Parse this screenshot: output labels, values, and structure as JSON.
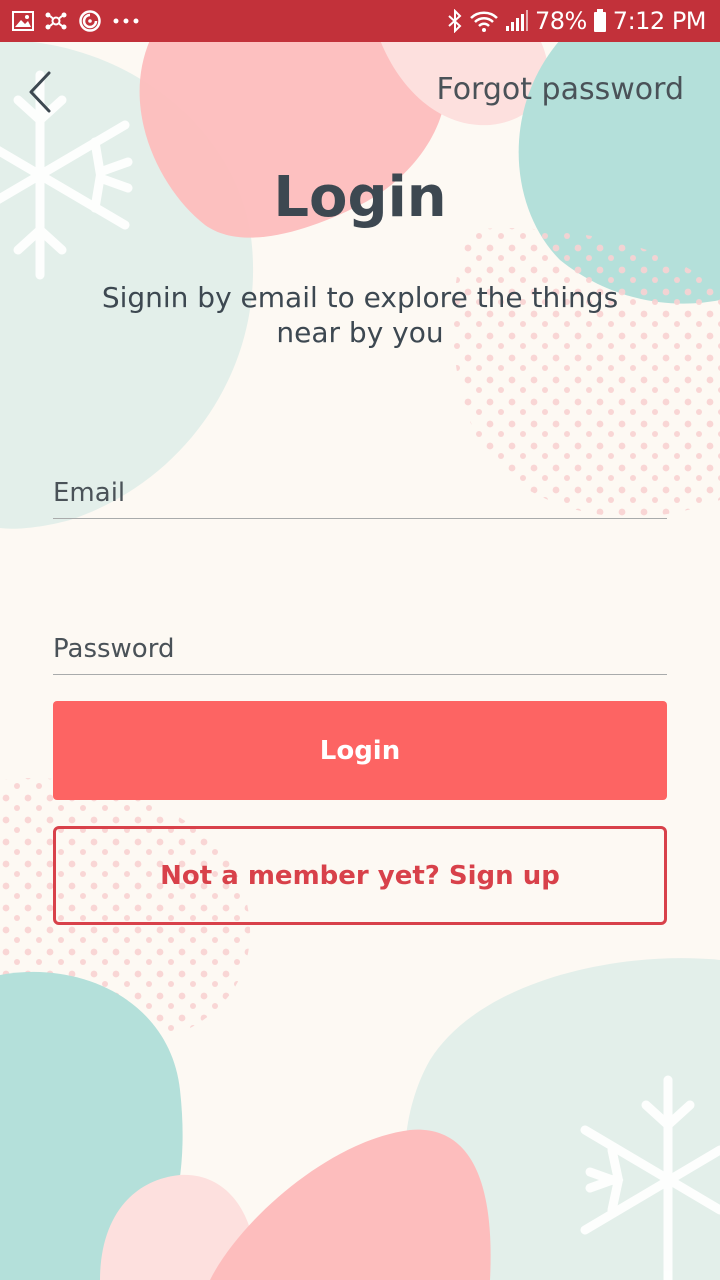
{
  "status_bar": {
    "battery_percent": "78%",
    "time": "7:12 PM",
    "left_icons": [
      "image-icon",
      "bluetooth-share-icon",
      "sync-icon",
      "more-dots-icon"
    ],
    "right_icons": [
      "bluetooth-icon",
      "wifi-icon",
      "signal-icon",
      "battery-icon"
    ],
    "background_color": "#c2313a"
  },
  "header": {
    "back_icon": "chevron-left-icon",
    "forgot_password": "Forgot password"
  },
  "main": {
    "title": "Login",
    "subtitle": "Signin by email to explore the things near by you"
  },
  "form": {
    "email_placeholder": "Email",
    "email_value": "",
    "password_placeholder": "Password",
    "password_value": "",
    "login_label": "Login",
    "signup_label": "Not a member yet? Sign up"
  },
  "theme": {
    "primary": "#fd6463",
    "accent": "#d8414a",
    "text": "#3d4851",
    "background": "#fdf9f3",
    "teal": "#b4e0da",
    "pink": "#fdbdbd"
  }
}
